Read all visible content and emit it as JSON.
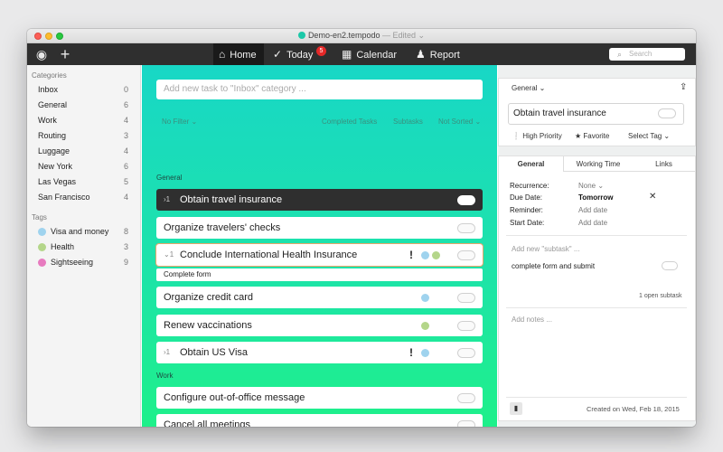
{
  "window": {
    "title": "Demo-en2.tempodo",
    "edited": "— Edited ⌄"
  },
  "toolbar": {
    "tabs": [
      {
        "label": "Home",
        "icon": "home-icon",
        "glyph": "⌂"
      },
      {
        "label": "Today",
        "icon": "check-circle-icon",
        "glyph": "✓"
      },
      {
        "label": "Calendar",
        "icon": "calendar-icon",
        "glyph": "▦"
      },
      {
        "label": "Report",
        "icon": "users-icon",
        "glyph": "♟"
      }
    ],
    "today_badge": "5",
    "search_placeholder": "Search"
  },
  "sidebar": {
    "categories_header": "Categories",
    "categories": [
      {
        "label": "Inbox",
        "count": "0"
      },
      {
        "label": "General",
        "count": "6"
      },
      {
        "label": "Work",
        "count": "4"
      },
      {
        "label": "Routing",
        "count": "3"
      },
      {
        "label": "Luggage",
        "count": "4"
      },
      {
        "label": "New York",
        "count": "6"
      },
      {
        "label": "Las Vegas",
        "count": "5"
      },
      {
        "label": "San Francisco",
        "count": "4"
      }
    ],
    "tags_header": "Tags",
    "tags": [
      {
        "label": "Visa and money",
        "count": "8",
        "color": "#9fd3ee"
      },
      {
        "label": "Health",
        "count": "3",
        "color": "#b4d68a"
      },
      {
        "label": "Sightseeing",
        "count": "9",
        "color": "#e77bbf"
      }
    ]
  },
  "main": {
    "new_task_placeholder": "Add new task to \"Inbox\" category ...",
    "filters": {
      "no_filter": "No Filter ⌄",
      "completed": "Completed Tasks",
      "subtasks": "Subtasks",
      "sort": "Not Sorted ⌄"
    },
    "section_general": "General",
    "section_work": "Work",
    "tasks": [
      {
        "title": "Obtain travel insurance",
        "twisty": "›1"
      },
      {
        "title": "Organize travelers' checks"
      },
      {
        "title": "Conclude International Health Insurance",
        "twisty": "⌄1",
        "priority": "!"
      },
      {
        "title": "Organize credit card"
      },
      {
        "title": "Renew vaccinations"
      },
      {
        "title": "Obtain US Visa",
        "twisty": "›1",
        "priority": "!"
      },
      {
        "title": "Configure out-of-office message"
      },
      {
        "title": "Cancel all meetings"
      }
    ],
    "subtask_title": "Complete form",
    "tag_colors": {
      "visa": "#9fd3ee",
      "health": "#b4d68a"
    }
  },
  "detail": {
    "category": "General ⌄",
    "title": "Obtain travel insurance",
    "high_priority": "High Priority",
    "favorite": "Favorite",
    "select_tag": "Select Tag ⌄",
    "tabs": [
      "General",
      "Working Time",
      "Links"
    ],
    "recurrence_label": "Recurrence:",
    "recurrence_value": "None ⌄",
    "due_label": "Due Date:",
    "due_value": "Tomorrow",
    "reminder_label": "Reminder:",
    "reminder_value": "Add date",
    "start_label": "Start Date:",
    "start_value": "Add date",
    "add_subtask": "Add new \"subtask\" ...",
    "subtask": "complete form and submit",
    "open_subtasks": "1 open subtask",
    "notes_placeholder": "Add notes ...",
    "created": "Created on Wed, Feb 18, 2015"
  }
}
